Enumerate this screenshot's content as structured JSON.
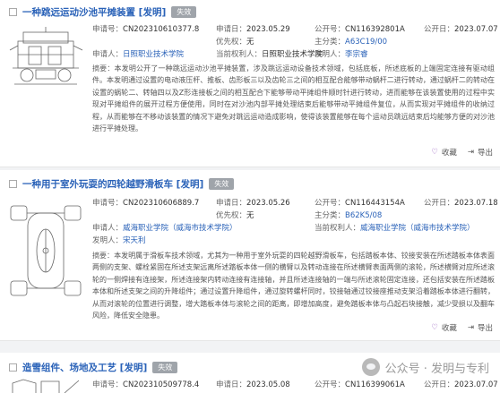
{
  "labels": {
    "app_no": "申请号：",
    "app_date": "申请日：",
    "pub_no": "公开号：",
    "pub_date": "公开日：",
    "priority": "优先权：",
    "main_class": "主分类：",
    "applicant": "申请人：",
    "patentee": "当前权利人：",
    "inventor": "发明人：",
    "abstract": "摘要："
  },
  "actions": {
    "favorite": "收藏",
    "export": "导出"
  },
  "patents": [
    {
      "title": "一种跳远运动沙池平摊装置 [发明]",
      "status": "失效",
      "app_no": "CN202310610377.8",
      "app_date": "2023.05.29",
      "pub_no": "CN116392801A",
      "pub_date": "2023.07.07",
      "priority": "无",
      "main_class": "A63C19/00",
      "applicant": "日照职业技术学院",
      "patentee": "日照职业技术学院",
      "inventor": "李宗睿",
      "abstract": "本发明公开了一种跳远运动沙池平摊装置，涉及跳远运动设备技术领域，包括底板，所述底板的上端固定连接有驱动组件。本发明通过设置的电动液压杆、推板、齿形板三以及齿轮三之间的相互配合能够带动蜗杆二进行转动，通过蜗杆二的转动在设置的蜗轮二、转轴四以及Z形连接板之间的相互配合下能够带动平摊组件顺时针进行转动，进而能够在该装置使用的过程中实现对平摊组件的展开过程方便使用，同时在对沙池内部平摊处理结束后能够带动平摊组件复位，从而实现对平摊组件的收纳过程，从而能够在不移动该装置的情况下避免对跳远运动造成影响，使得该装置能够在每个运动员跳远结束后均能够方便的对沙池进行平摊处理。"
    },
    {
      "title": "一种用于室外玩耍的四轮越野滑板车 [发明]",
      "status": "失效",
      "app_no": "CN202310606889.7",
      "app_date": "2023.05.26",
      "pub_no": "CN116443154A",
      "pub_date": "2023.07.18",
      "priority": "无",
      "main_class": "B62K5/08",
      "applicant": "威海职业学院（威海市技术学院）",
      "patentee": "威海职业学院（威海市技术学院）",
      "inventor": "宋天利",
      "abstract": "本发明属于滑板车技术领域，尤其为一种用于室外玩耍的四轮越野滑板车，包括踏板本体、铰接安装在所述踏板本体表面两侧的支架、螺栓紧固在所述支架远离所述踏板本体一侧的横臂以及转动连接在所述横臂表面两侧的滚轮，所述横臂对应所述滚轮的一侧焊接有连接架，所述连接架内转动连接有连接轴，并且所述连接轴的一端与所述滚轮固定连接，还包括安装在所述踏板本体和所述支架之间的升降组件；通过设置升降组件，通过旋转螺杆同时，铰接轴通过铰接座推动支架沿着踏板本体进行翻转，从而对滚轮的位置进行调整，增大踏板本体与滚轮之间的距离，即增加高度，避免踏板本体与凸起石块接触，减少受损以及翻车风险，降低安全隐患。"
    },
    {
      "title": "造雪组件、场地及工艺 [发明]",
      "status": "失效",
      "app_no": "CN202310509778.4",
      "app_date": "2023.05.08",
      "pub_no": "CN116399061A",
      "pub_date": "2023.07.07"
    }
  ],
  "watermark": "公众号 · 发明与专利"
}
